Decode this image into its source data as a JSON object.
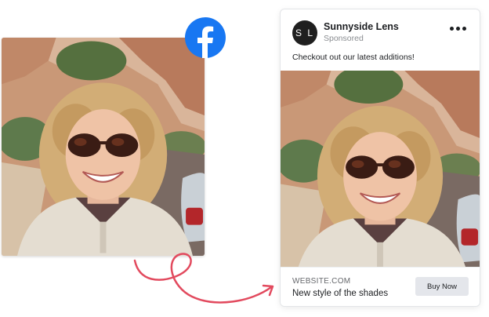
{
  "ad": {
    "avatar_initials": "S L",
    "page_name": "Sunnyside Lens",
    "sponsored_label": "Sponsored",
    "caption": "Checkout out our latest additions!",
    "website": "WEBSITE.COM",
    "headline": "New style of the shades",
    "cta_label": "Buy Now"
  },
  "icons": {
    "facebook": "facebook-logo-icon",
    "more": "more-options-icon",
    "arrow": "curly-arrow-icon"
  },
  "colors": {
    "facebook_blue": "#1877F2",
    "arrow_red": "#E24A5E",
    "avatar_bg": "#1F1F1F",
    "cta_bg": "#E4E6EB"
  }
}
